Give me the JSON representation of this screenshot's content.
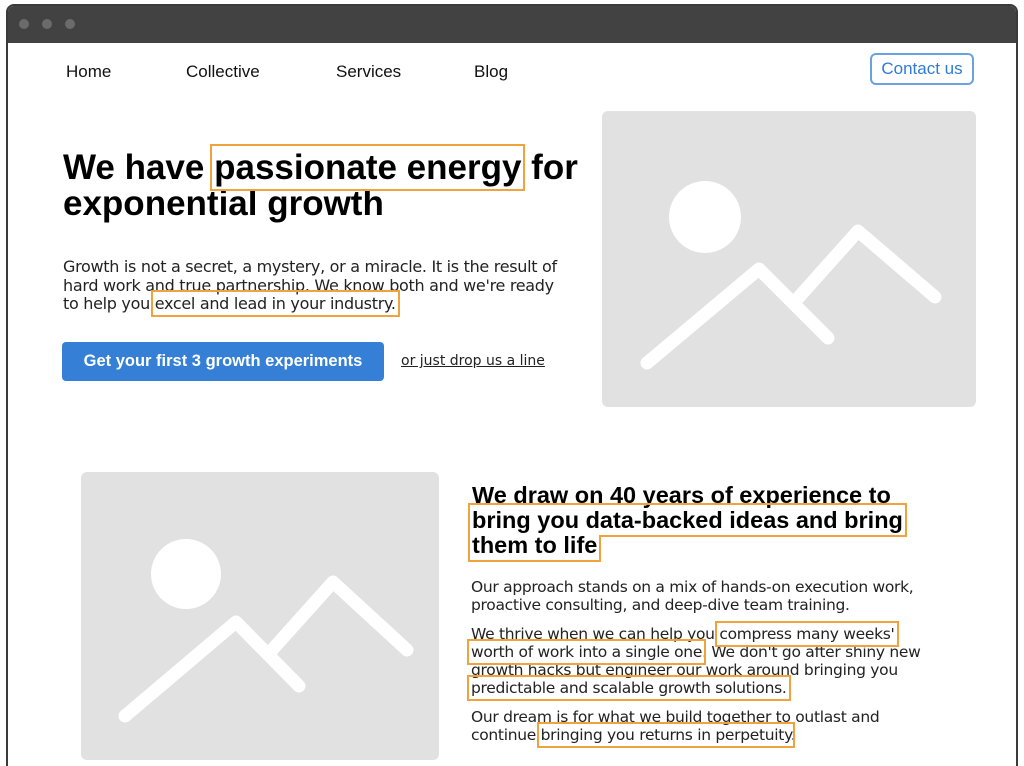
{
  "nav": {
    "items": [
      "Home",
      "Collective",
      "Services",
      "Blog"
    ],
    "contact_label": "Contact us"
  },
  "hero": {
    "title_before": "We have ",
    "title_highlight": "passionate energy",
    "title_after": " for exponential growth",
    "body_before": "Growth is not a secret, a mystery, or a miracle. It is the result of hard work and true partnership. We know both and we're ready to help you ",
    "body_highlight": "excel and lead in your industry.",
    "cta_label": "Get your first 3 growth experiments",
    "link_label": "or just drop us a line"
  },
  "section2": {
    "title_before": "We draw on 40 years of experience to ",
    "title_highlight": "bring you data-backed ideas and bring them to life",
    "p1": "Our approach stands on a mix of hands-on execution work, proactive consulting, and deep-dive team training.",
    "p2_a": "We thrive when we can help you ",
    "p2_h1": "compress many weeks' worth of work into a single one",
    "p2_b": ". We don't go after shiny new growth hacks but engineer our work around bringing you ",
    "p2_h2": "predictable and scalable growth solutions.",
    "p3_a": "Our dream is for what we build together to outlast and continue ",
    "p3_h": "bringing you returns in perpetuity",
    "p3_b": "."
  },
  "colors": {
    "accent": "#3580d6",
    "highlight_outline": "#f0a33c",
    "placeholder": "#e1e1e1"
  },
  "icons": {
    "placeholder_image": "image-placeholder-icon"
  }
}
